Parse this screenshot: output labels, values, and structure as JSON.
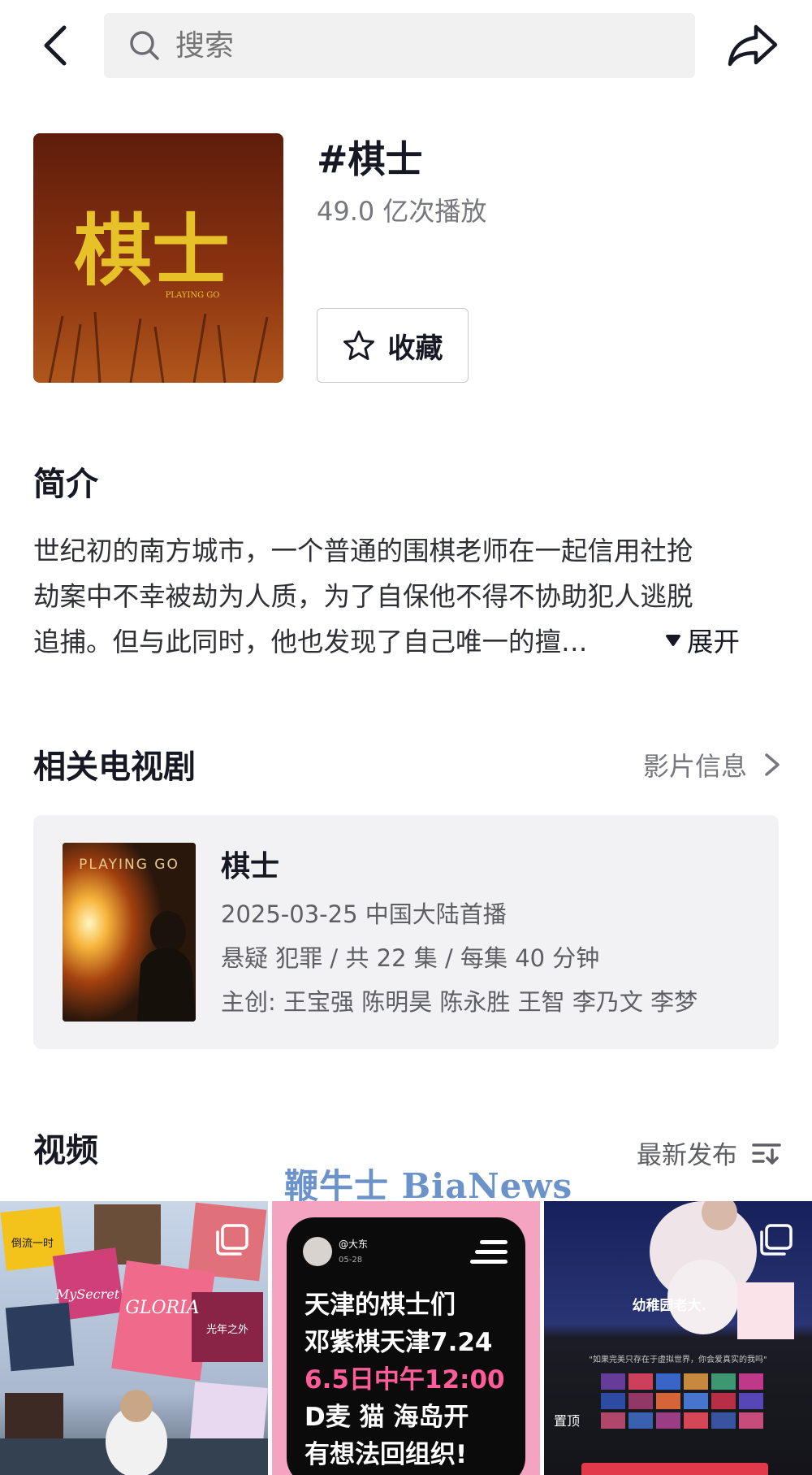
{
  "search": {
    "placeholder": "搜索"
  },
  "topic": {
    "title": "#棋士",
    "plays": "49.0 亿次播放",
    "collect_label": "收藏",
    "cover_title": "棋士",
    "cover_subtitle": "PLAYING GO"
  },
  "intro": {
    "title": "简介",
    "lines": [
      "世纪初的南方城市，一个普通的围棋老师在一起信用社抢",
      "劫案中不幸被劫为人质，为了自保他不得不协助犯人逃脱",
      "追捕。但与此同时，他也发现了自己唯一的擅…"
    ],
    "expand_label": "展开"
  },
  "related": {
    "title": "相关电视剧",
    "more_label": "影片信息",
    "drama": {
      "poster_text": "PLAYING GO",
      "title": "棋士",
      "premiere": "2025-03-25 中国大陆首播",
      "info": "悬疑 犯罪 / 共 22 集 / 每集 40 分钟",
      "cast": "主创: 王宝强 陈明昊 陈永胜 王智 李乃文 李梦"
    }
  },
  "videos": {
    "title": "视频",
    "sort_label": "最新发布",
    "watermark": "鞭牛士 BiaNews",
    "tiles": [
      {
        "album_labels": [
          "倒流一时",
          "MySecret",
          "GLORIA",
          "光年之外"
        ]
      },
      {
        "user": "@大东",
        "date": "05-28",
        "lines": [
          "天津的棋士们",
          "邓紫棋天津7.24",
          "6.5日中午12:00",
          "D麦 猫 海岛开",
          "有想法回组织!"
        ]
      },
      {
        "caption": "幼稚园老大.",
        "quote": "\"如果完美只存在于虚拟世界，你会爱真实的我吗\"",
        "pin_label": "置顶"
      }
    ]
  }
}
